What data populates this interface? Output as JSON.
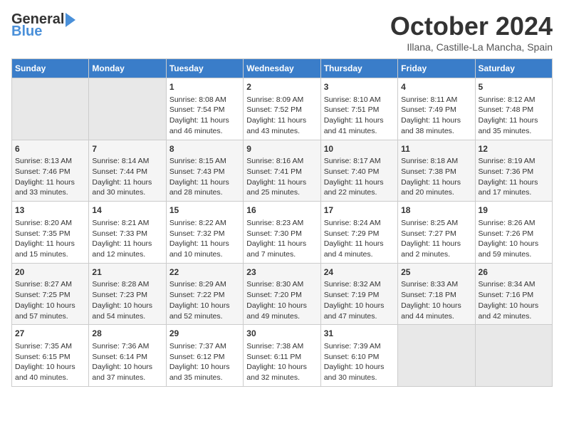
{
  "header": {
    "logo_general": "General",
    "logo_blue": "Blue",
    "title": "October 2024",
    "location": "Illana, Castille-La Mancha, Spain"
  },
  "days_of_week": [
    "Sunday",
    "Monday",
    "Tuesday",
    "Wednesday",
    "Thursday",
    "Friday",
    "Saturday"
  ],
  "weeks": [
    [
      {
        "day": "",
        "info": ""
      },
      {
        "day": "",
        "info": ""
      },
      {
        "day": "1",
        "info": "Sunrise: 8:08 AM\nSunset: 7:54 PM\nDaylight: 11 hours and 46 minutes."
      },
      {
        "day": "2",
        "info": "Sunrise: 8:09 AM\nSunset: 7:52 PM\nDaylight: 11 hours and 43 minutes."
      },
      {
        "day": "3",
        "info": "Sunrise: 8:10 AM\nSunset: 7:51 PM\nDaylight: 11 hours and 41 minutes."
      },
      {
        "day": "4",
        "info": "Sunrise: 8:11 AM\nSunset: 7:49 PM\nDaylight: 11 hours and 38 minutes."
      },
      {
        "day": "5",
        "info": "Sunrise: 8:12 AM\nSunset: 7:48 PM\nDaylight: 11 hours and 35 minutes."
      }
    ],
    [
      {
        "day": "6",
        "info": "Sunrise: 8:13 AM\nSunset: 7:46 PM\nDaylight: 11 hours and 33 minutes."
      },
      {
        "day": "7",
        "info": "Sunrise: 8:14 AM\nSunset: 7:44 PM\nDaylight: 11 hours and 30 minutes."
      },
      {
        "day": "8",
        "info": "Sunrise: 8:15 AM\nSunset: 7:43 PM\nDaylight: 11 hours and 28 minutes."
      },
      {
        "day": "9",
        "info": "Sunrise: 8:16 AM\nSunset: 7:41 PM\nDaylight: 11 hours and 25 minutes."
      },
      {
        "day": "10",
        "info": "Sunrise: 8:17 AM\nSunset: 7:40 PM\nDaylight: 11 hours and 22 minutes."
      },
      {
        "day": "11",
        "info": "Sunrise: 8:18 AM\nSunset: 7:38 PM\nDaylight: 11 hours and 20 minutes."
      },
      {
        "day": "12",
        "info": "Sunrise: 8:19 AM\nSunset: 7:36 PM\nDaylight: 11 hours and 17 minutes."
      }
    ],
    [
      {
        "day": "13",
        "info": "Sunrise: 8:20 AM\nSunset: 7:35 PM\nDaylight: 11 hours and 15 minutes."
      },
      {
        "day": "14",
        "info": "Sunrise: 8:21 AM\nSunset: 7:33 PM\nDaylight: 11 hours and 12 minutes."
      },
      {
        "day": "15",
        "info": "Sunrise: 8:22 AM\nSunset: 7:32 PM\nDaylight: 11 hours and 10 minutes."
      },
      {
        "day": "16",
        "info": "Sunrise: 8:23 AM\nSunset: 7:30 PM\nDaylight: 11 hours and 7 minutes."
      },
      {
        "day": "17",
        "info": "Sunrise: 8:24 AM\nSunset: 7:29 PM\nDaylight: 11 hours and 4 minutes."
      },
      {
        "day": "18",
        "info": "Sunrise: 8:25 AM\nSunset: 7:27 PM\nDaylight: 11 hours and 2 minutes."
      },
      {
        "day": "19",
        "info": "Sunrise: 8:26 AM\nSunset: 7:26 PM\nDaylight: 10 hours and 59 minutes."
      }
    ],
    [
      {
        "day": "20",
        "info": "Sunrise: 8:27 AM\nSunset: 7:25 PM\nDaylight: 10 hours and 57 minutes."
      },
      {
        "day": "21",
        "info": "Sunrise: 8:28 AM\nSunset: 7:23 PM\nDaylight: 10 hours and 54 minutes."
      },
      {
        "day": "22",
        "info": "Sunrise: 8:29 AM\nSunset: 7:22 PM\nDaylight: 10 hours and 52 minutes."
      },
      {
        "day": "23",
        "info": "Sunrise: 8:30 AM\nSunset: 7:20 PM\nDaylight: 10 hours and 49 minutes."
      },
      {
        "day": "24",
        "info": "Sunrise: 8:32 AM\nSunset: 7:19 PM\nDaylight: 10 hours and 47 minutes."
      },
      {
        "day": "25",
        "info": "Sunrise: 8:33 AM\nSunset: 7:18 PM\nDaylight: 10 hours and 44 minutes."
      },
      {
        "day": "26",
        "info": "Sunrise: 8:34 AM\nSunset: 7:16 PM\nDaylight: 10 hours and 42 minutes."
      }
    ],
    [
      {
        "day": "27",
        "info": "Sunrise: 7:35 AM\nSunset: 6:15 PM\nDaylight: 10 hours and 40 minutes."
      },
      {
        "day": "28",
        "info": "Sunrise: 7:36 AM\nSunset: 6:14 PM\nDaylight: 10 hours and 37 minutes."
      },
      {
        "day": "29",
        "info": "Sunrise: 7:37 AM\nSunset: 6:12 PM\nDaylight: 10 hours and 35 minutes."
      },
      {
        "day": "30",
        "info": "Sunrise: 7:38 AM\nSunset: 6:11 PM\nDaylight: 10 hours and 32 minutes."
      },
      {
        "day": "31",
        "info": "Sunrise: 7:39 AM\nSunset: 6:10 PM\nDaylight: 10 hours and 30 minutes."
      },
      {
        "day": "",
        "info": ""
      },
      {
        "day": "",
        "info": ""
      }
    ]
  ]
}
